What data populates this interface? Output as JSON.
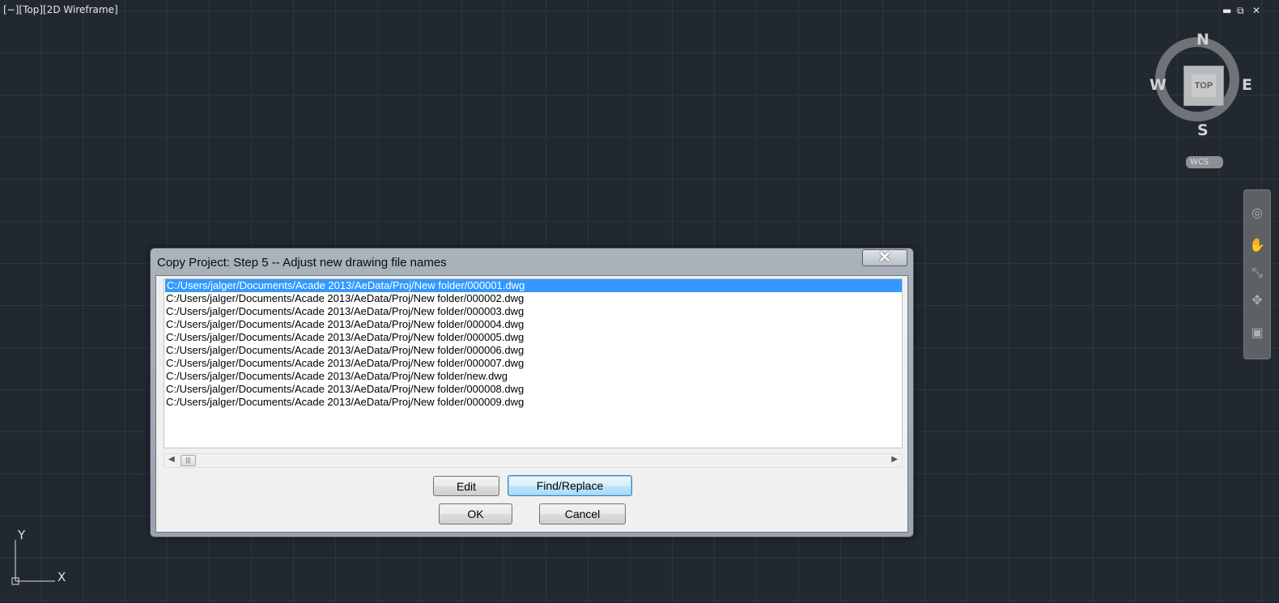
{
  "viewport": {
    "label": "[−][Top][2D Wireframe]",
    "minimize": "▬",
    "restore": "⧉",
    "close": "✕"
  },
  "viewcube": {
    "face": "TOP",
    "north": "N",
    "south": "S",
    "east": "E",
    "west": "W",
    "wcs": "WCS"
  },
  "ucs": {
    "x_label": "X",
    "y_label": "Y"
  },
  "dialog": {
    "title": "Copy Project: Step 5 -- Adjust new drawing file names",
    "close_icon": "✕",
    "files": [
      "C:/Users/jalger/Documents/Acade 2013/AeData/Proj/New folder/000001.dwg",
      "C:/Users/jalger/Documents/Acade 2013/AeData/Proj/New folder/000002.dwg",
      "C:/Users/jalger/Documents/Acade 2013/AeData/Proj/New folder/000003.dwg",
      "C:/Users/jalger/Documents/Acade 2013/AeData/Proj/New folder/000004.dwg",
      "C:/Users/jalger/Documents/Acade 2013/AeData/Proj/New folder/000005.dwg",
      "C:/Users/jalger/Documents/Acade 2013/AeData/Proj/New folder/000006.dwg",
      "C:/Users/jalger/Documents/Acade 2013/AeData/Proj/New folder/000007.dwg",
      "C:/Users/jalger/Documents/Acade 2013/AeData/Proj/New folder/new.dwg",
      "C:/Users/jalger/Documents/Acade 2013/AeData/Proj/New folder/000008.dwg",
      "C:/Users/jalger/Documents/Acade 2013/AeData/Proj/New folder/000009.dwg"
    ],
    "selected_index": 0,
    "buttons": {
      "edit": "Edit",
      "find_replace": "Find/Replace",
      "ok": "OK",
      "cancel": "Cancel"
    }
  },
  "colors": {
    "canvas": "#212830",
    "selection": "#3399ff"
  }
}
